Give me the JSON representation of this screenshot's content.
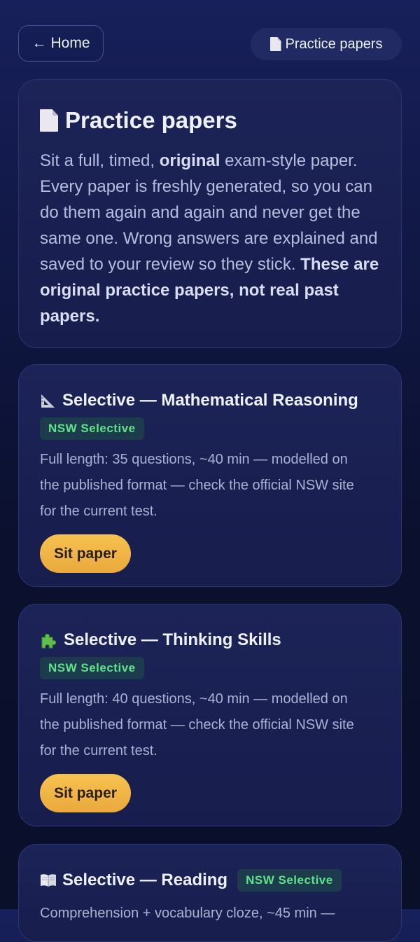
{
  "nav": {
    "home_label": "Home",
    "home_arrow": "←",
    "current_page": "Practice papers"
  },
  "intro": {
    "title": "Practice papers",
    "text_1": "Sit a full, timed, ",
    "text_bold_1": "original",
    "text_2": " exam-style paper. Every paper is freshly generated, so you can do them again and again and never get the same one. Wrong answers are explained and saved to your review so they stick. ",
    "text_bold_2": "These are original practice papers, not real past papers."
  },
  "papers": [
    {
      "icon": "ruler-icon",
      "title": "Selective — Mathematical Reasoning",
      "badge": "NSW Selective",
      "description": "Full length: 35 questions, ~40 min — modelled on the published format — check the official NSW site for the current test.",
      "button": "Sit paper"
    },
    {
      "icon": "puzzle-icon",
      "title": "Selective — Thinking Skills",
      "badge": "NSW Selective",
      "description": "Full length: 40 questions, ~40 min — modelled on the published format — check the official NSW site for the current test.",
      "button": "Sit paper"
    },
    {
      "icon": "book-icon",
      "title": "Selective — Reading",
      "badge": "NSW Selective",
      "description": "Comprehension + vocabulary cloze, ~45 min —"
    }
  ],
  "colors": {
    "accent": "#f0b646",
    "badge_text": "#5ee38a",
    "badge_bg": "#1c3b4c",
    "background": "#0f1640"
  }
}
